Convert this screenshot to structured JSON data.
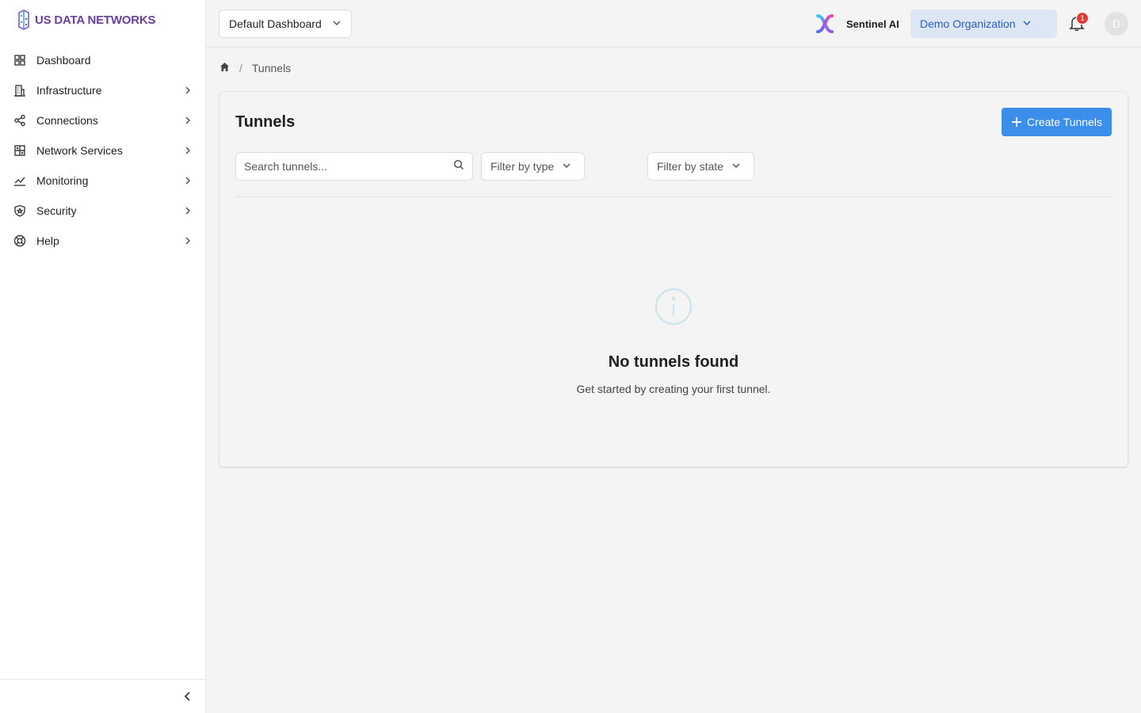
{
  "brand": {
    "name": "US DATA NETWORKS",
    "color": "#6b3fa0"
  },
  "sidebar": {
    "items": [
      {
        "label": "Dashboard",
        "icon": "grid-icon",
        "has_children": false
      },
      {
        "label": "Infrastructure",
        "icon": "building-icon",
        "has_children": true
      },
      {
        "label": "Connections",
        "icon": "share-nodes-icon",
        "has_children": true
      },
      {
        "label": "Network Services",
        "icon": "server-grid-icon",
        "has_children": true
      },
      {
        "label": "Monitoring",
        "icon": "line-chart-icon",
        "has_children": true
      },
      {
        "label": "Security",
        "icon": "shield-icon",
        "has_children": true
      },
      {
        "label": "Help",
        "icon": "lifebuoy-icon",
        "has_children": true
      }
    ],
    "collapse_icon": "chevron-left-icon"
  },
  "header": {
    "dashboard_select": "Default Dashboard",
    "assistant_label": "Sentinel AI",
    "org_select": "Demo Organization",
    "notifications_count": "1",
    "avatar_initial": "D"
  },
  "breadcrumb": {
    "current": "Tunnels"
  },
  "main": {
    "title": "Tunnels",
    "create_button": "Create Tunnels",
    "search_placeholder": "Search tunnels...",
    "filter_type": "Filter by type",
    "filter_state": "Filter by state",
    "empty_title": "No tunnels found",
    "empty_subtitle": "Get started by creating your first tunnel."
  },
  "colors": {
    "accent": "#3b8eea",
    "badge": "#e53935",
    "org_bg": "#dde6f4",
    "org_text": "#2b5fb8"
  }
}
